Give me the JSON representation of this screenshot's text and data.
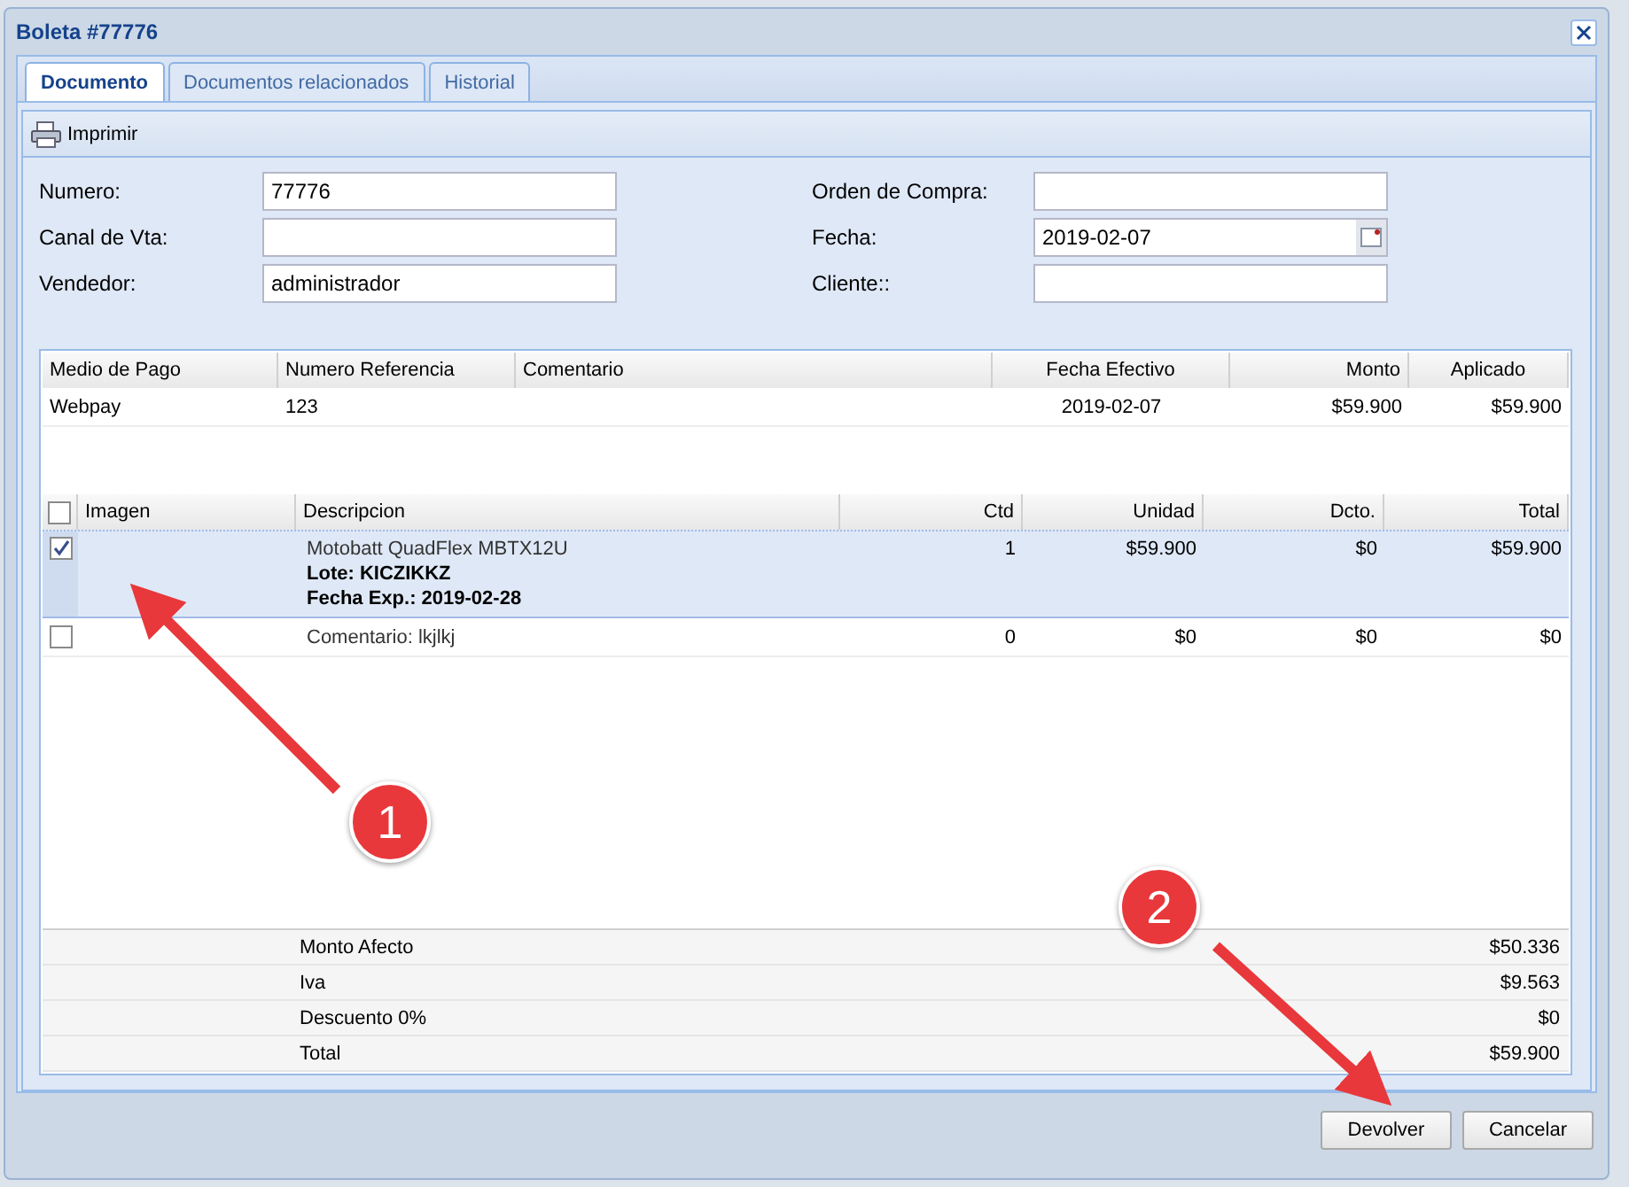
{
  "window": {
    "title": "Boleta #77776"
  },
  "tabs": [
    {
      "label": "Documento",
      "selected": true
    },
    {
      "label": "Documentos relacionados",
      "selected": false
    },
    {
      "label": "Historial",
      "selected": false
    }
  ],
  "toolbar": {
    "print_label": "Imprimir"
  },
  "form_left": [
    {
      "label": "Numero:",
      "value": "77776"
    },
    {
      "label": "Canal de Vta:"
    },
    {
      "label": "Vendedor:",
      "value": "administrador"
    }
  ],
  "form_right": [
    {
      "label": "Orden de Compra:",
      "kind": "text"
    },
    {
      "label": "Fecha:",
      "value": "2019-02-07",
      "kind": "date"
    },
    {
      "label": "Cliente::",
      "kind": "text"
    }
  ],
  "payments": {
    "columns": [
      "Medio de Pago",
      "Numero Referencia",
      "Comentario",
      "Fecha Efectivo",
      "Monto",
      "Aplicado"
    ],
    "rows": [
      [
        "Webpay",
        "123",
        null,
        "2019-02-07",
        "$59.900",
        "$59.900"
      ]
    ]
  },
  "items": {
    "header_checked": false,
    "columns": [
      "Imagen",
      "Descripcion",
      "Ctd",
      "Unidad",
      "Dcto.",
      "Total"
    ],
    "rows": [
      {
        "checked": true,
        "selected": true,
        "description": "Motobatt QuadFlex MBTX12U",
        "details": [
          "Lote: KICZIKKZ",
          "Fecha Exp.: 2019-02-28"
        ],
        "ctd": "1",
        "unidad": "$59.900",
        "dcto": "$0",
        "total": "$59.900"
      },
      {
        "checked": false,
        "selected": false,
        "description": "Comentario: lkjlkj",
        "details": [],
        "ctd": "0",
        "unidad": "$0",
        "dcto": "$0",
        "total": "$0"
      }
    ]
  },
  "summary": [
    {
      "label": "Monto Afecto",
      "value": "$50.336"
    },
    {
      "label": "Iva",
      "value": "$9.563"
    },
    {
      "label": "Descuento 0%",
      "value": "$0"
    },
    {
      "label": "Total",
      "value": "$59.900"
    }
  ],
  "buttons": [
    "Devolver",
    "Cancelar"
  ],
  "annotations": [
    {
      "number": "1"
    },
    {
      "number": "2"
    }
  ]
}
